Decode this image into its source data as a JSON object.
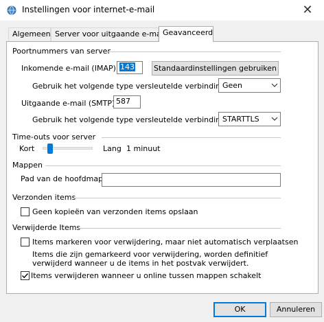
{
  "window": {
    "title": "Instellingen voor internet-e-mail",
    "close_glyph": "✕"
  },
  "tabs": [
    {
      "label": "Algemeen",
      "active": false
    },
    {
      "label": "Server voor uitgaande e-mail",
      "active": false
    },
    {
      "label": "Geavanceerd",
      "active": true
    }
  ],
  "server_ports": {
    "group_label": "Poortnummers van server",
    "incoming_label": "Inkomende e-mail (IMAP):",
    "incoming_value": "143",
    "defaults_button": "Standaardinstellingen gebruiken",
    "incoming_encryption_label": "Gebruik het volgende type versleutelde verbinding:",
    "incoming_encryption_value": "Geen",
    "outgoing_label": "Uitgaande e-mail (SMTP):",
    "outgoing_value": "587",
    "outgoing_encryption_label": "Gebruik het volgende type versleutelde verbinding:",
    "outgoing_encryption_value": "STARTTLS"
  },
  "timeouts": {
    "group_label": "Time-outs voor server",
    "short_label": "Kort",
    "long_label": "Lang",
    "value_text": "1 minuut",
    "slider_fraction": 0.1
  },
  "folders": {
    "group_label": "Mappen",
    "root_folder_label": "Pad van de hoofdmap:",
    "root_folder_value": ""
  },
  "sent_items": {
    "group_label": "Verzonden items",
    "no_copies_label": "Geen kopieën van verzonden items opslaan",
    "no_copies_checked": false
  },
  "deleted_items": {
    "group_label": "Verwijderde Items",
    "mark_label": "Items markeren voor verwijdering, maar niet automatisch verplaatsen",
    "mark_checked": false,
    "note_line1": "Items die zijn gemarkeerd voor verwijdering, worden definitief",
    "note_line2": "verwijderd wanneer u de items in het postvak verwijdert.",
    "purge_label": "Items verwijderen wanneer u online tussen mappen schakelt",
    "purge_checked": true
  },
  "buttons": {
    "ok": "OK",
    "cancel": "Annuleren"
  },
  "colors": {
    "accent": "#0078d7",
    "selection": "#0078d7"
  },
  "icons": {
    "title": "globe-icon",
    "close": "close-icon",
    "dropdown": "chevron-down-icon",
    "check": "check-icon"
  }
}
